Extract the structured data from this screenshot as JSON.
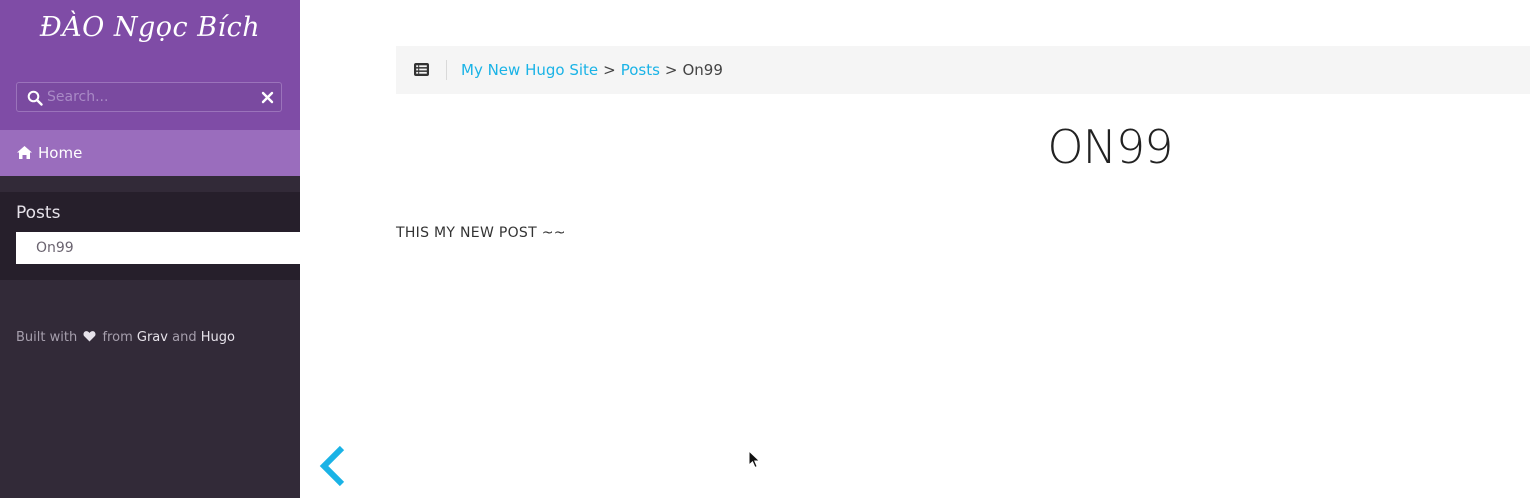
{
  "sidebar": {
    "logo_text": "ĐÀO Ngọc Bích",
    "search": {
      "placeholder": "Search...",
      "value": ""
    },
    "home": {
      "icon": "home-icon",
      "label": "Home"
    },
    "section": {
      "title": "Posts",
      "items": [
        {
          "label": "On99"
        }
      ]
    },
    "footer": {
      "prefix": "Built with",
      "heart_icon": "heart-icon",
      "from": "from",
      "grav": "Grav",
      "and": "and",
      "hugo": "Hugo"
    }
  },
  "topbar": {
    "toc_icon": "list-icon",
    "breadcrumb": {
      "items": [
        {
          "label": "My New Hugo Site"
        },
        {
          "label": "Posts"
        }
      ],
      "separator": ">",
      "current": "On99"
    }
  },
  "content": {
    "title": "ON99",
    "body": "THIS MY NEW POST ~~"
  },
  "navigation": {
    "prev_icon": "chevron-left-icon"
  },
  "colors": {
    "sidebar_header": "#7f4ca6",
    "sidebar_active": "#9a6dbd",
    "sidebar_bg": "#322a38",
    "link": "#1ab3e6"
  }
}
